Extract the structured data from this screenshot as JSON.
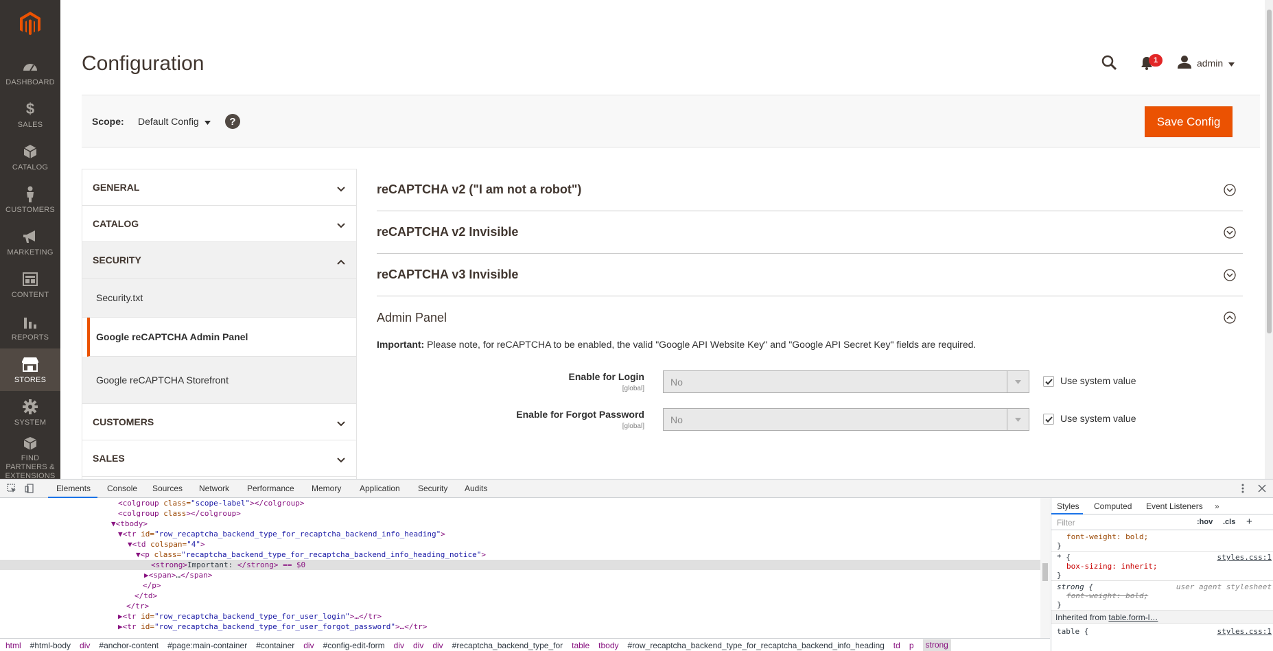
{
  "sidebar": {
    "logo": "magento-logo",
    "items": [
      {
        "label": "DASHBOARD",
        "icon": "dashboard-icon"
      },
      {
        "label": "SALES",
        "icon": "dollar-icon"
      },
      {
        "label": "CATALOG",
        "icon": "cube-icon"
      },
      {
        "label": "CUSTOMERS",
        "icon": "person-icon"
      },
      {
        "label": "MARKETING",
        "icon": "megaphone-icon"
      },
      {
        "label": "CONTENT",
        "icon": "layout-icon"
      },
      {
        "label": "REPORTS",
        "icon": "bar-chart-icon"
      },
      {
        "label": "STORES",
        "icon": "store-icon"
      },
      {
        "label": "SYSTEM",
        "icon": "gear-icon"
      },
      {
        "label": "FIND PARTNERS & EXTENSIONS",
        "icon": "blocks-icon"
      }
    ]
  },
  "header": {
    "title": "Configuration",
    "notifications_count": "1",
    "user": "admin"
  },
  "scope": {
    "label": "Scope:",
    "value": "Default Config",
    "help": "?",
    "save_label": "Save Config"
  },
  "tabs": {
    "general": "GENERAL",
    "catalog": "CATALOG",
    "security": "SECURITY",
    "security_items": [
      "Security.txt",
      "Google reCAPTCHA Admin Panel",
      "Google reCAPTCHA Storefront"
    ],
    "customers": "CUSTOMERS",
    "sales": "SALES"
  },
  "sections": {
    "s1": "reCAPTCHA v2 (\"I am not a robot\")",
    "s2": "reCAPTCHA v2 Invisible",
    "s3": "reCAPTCHA v3 Invisible",
    "s4": "Admin Panel",
    "notice_strong": "Important:",
    "notice_text": " Please note, for reCAPTCHA to be enabled, the valid \"Google API Website Key\" and \"Google API Secret Key\" fields are required.",
    "rows": [
      {
        "label": "Enable for Login",
        "scope": "[global]",
        "value": "No",
        "checkbox": "Use system value"
      },
      {
        "label": "Enable for Forgot Password",
        "scope": "[global]",
        "value": "No",
        "checkbox": "Use system value"
      }
    ]
  },
  "devtools": {
    "tabs": [
      "Elements",
      "Console",
      "Sources",
      "Network",
      "Performance",
      "Memory",
      "Application",
      "Security",
      "Audits"
    ],
    "dom_lines": [
      {
        "tag": "<colgroup ",
        "attr": "class=",
        "val": "\"scope-label\"",
        "rest": "></colgroup>"
      },
      {
        "tag": "<colgroup ",
        "attr": "class",
        "val": "",
        "rest": "></colgroup>"
      },
      {
        "tag": "▼<tbody>",
        "attr": "",
        "val": "",
        "rest": ""
      },
      {
        "tag": "▼<tr ",
        "attr": "id=",
        "val": "\"row_recaptcha_backend_type_for_recaptcha_backend_info_heading\"",
        "rest": ">"
      },
      {
        "tag": "▼<td ",
        "attr": "colspan=",
        "val": "\"4\"",
        "rest": ">"
      },
      {
        "tag": "▼<p ",
        "attr": "class=",
        "val": "\"recaptcha_backend_type_for_recaptcha_backend_info_heading_notice\"",
        "rest": ">"
      },
      {
        "tag": "<strong>",
        "attr": "",
        "val": "Important: ",
        "rest": "</strong> == $0"
      },
      {
        "tag": "▶<span>",
        "attr": "",
        "val": "…",
        "rest": "</span>"
      },
      {
        "tag": "</p>",
        "attr": "",
        "val": "",
        "rest": ""
      },
      {
        "tag": "</td>",
        "attr": "",
        "val": "",
        "rest": ""
      },
      {
        "tag": "</tr>",
        "attr": "",
        "val": "",
        "rest": ""
      },
      {
        "tag": "▶<tr ",
        "attr": "id=",
        "val": "\"row_recaptcha_backend_type_for_user_login\"",
        "rest": ">…</tr>"
      },
      {
        "tag": "▶<tr ",
        "attr": "id=",
        "val": "\"row_recaptcha_backend_type_for_user_forgot_password\"",
        "rest": ">…</tr>"
      }
    ],
    "styles_tabs": [
      "Styles",
      "Computed",
      "Event Listeners"
    ],
    "filter_placeholder": "Filter",
    "hov": ":hov",
    "cls": ".cls",
    "style_lines": {
      "l1": "font-weight: bold;",
      "l2": "}",
      "l3": "* {",
      "l3src": "styles.css:1",
      "l4": "box-sizing: inherit;",
      "l5": "}",
      "l6": "strong {",
      "l6src": "user agent stylesheet",
      "l7": "font-weight: bold;",
      "l8": "}",
      "l9": "Inherited from",
      "l9link": "table.form-l…",
      "l10": "table {",
      "l10src": "styles.css:1"
    },
    "breadcrumbs": [
      "html",
      "#html-body",
      "div",
      "#anchor-content",
      "#page:main-container",
      "#container",
      "div",
      "#config-edit-form",
      "div",
      "div",
      "div",
      "#recaptcha_backend_type_for",
      "table",
      "tbody",
      "#row_recaptcha_backend_type_for_recaptcha_backend_info_heading",
      "td",
      "p",
      "strong"
    ]
  },
  "colors": {
    "accent": "#eb5202",
    "sidebar": "#373330",
    "badge": "#e22626"
  }
}
